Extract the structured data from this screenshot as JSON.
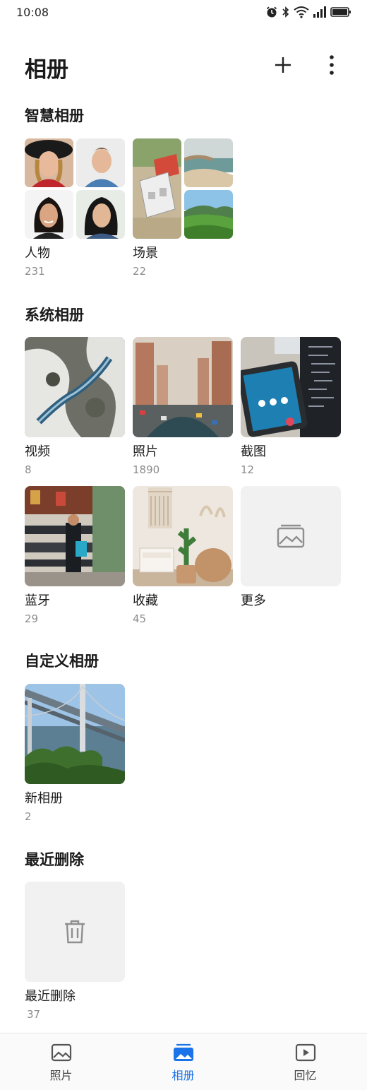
{
  "status_bar": {
    "time": "10:08"
  },
  "header": {
    "title": "相册"
  },
  "sections": {
    "smart": {
      "title": "智慧相册",
      "albums": [
        {
          "name": "人物",
          "count": "231"
        },
        {
          "name": "场景",
          "count": "22"
        }
      ]
    },
    "system": {
      "title": "系统相册",
      "albums": [
        {
          "name": "视频",
          "count": "8"
        },
        {
          "name": "照片",
          "count": "1890"
        },
        {
          "name": "截图",
          "count": "12"
        },
        {
          "name": "蓝牙",
          "count": "29"
        },
        {
          "name": "收藏",
          "count": "45"
        },
        {
          "name": "更多"
        }
      ]
    },
    "custom": {
      "title": "自定义相册",
      "albums": [
        {
          "name": "新相册",
          "count": "2"
        }
      ]
    },
    "recent": {
      "title": "最近删除",
      "albums": [
        {
          "name": "最近删除",
          "count": "37"
        }
      ]
    }
  },
  "bottom_nav": {
    "items": [
      {
        "label": "照片",
        "icon": "photo-icon"
      },
      {
        "label": "相册",
        "icon": "albums-icon",
        "active": true
      },
      {
        "label": "回忆",
        "icon": "play-icon"
      }
    ]
  },
  "colors": {
    "accent": "#1a73e8",
    "placeholder": "#f1f1f1",
    "count_text": "#8c8c8c"
  }
}
